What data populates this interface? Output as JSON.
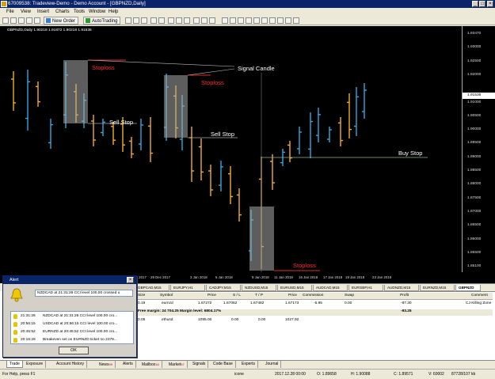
{
  "window": {
    "title": "67009538: Tradeview-Demo - Demo Account - [GBPNZD,Daily]",
    "min": "_",
    "max": "□",
    "close": "×"
  },
  "menu": [
    "File",
    "View",
    "Insert",
    "Charts",
    "Tools",
    "Window",
    "Help"
  ],
  "toolbar": {
    "new_order": "New Order",
    "autotrading": "AutoTrading"
  },
  "chart": {
    "header": "GBPNZD,Daily  1.90218 1.91872 1.90218 1.91536",
    "prices": [
      "1.93470",
      "1.93000",
      "1.92500",
      "1.92000",
      "1.91536",
      "1.91000",
      "1.90500",
      "1.90000",
      "1.89500",
      "1.89000",
      "1.88500",
      "1.88000",
      "1.87500",
      "1.87000",
      "1.86500",
      "1.86000",
      "1.85500",
      "1.85100"
    ],
    "dates": [
      "27 Dec 2017",
      "29 Dec 2017",
      "3 Jan 2018",
      "5 Jan 2018",
      "9 Jan 2018",
      "11 Jan 2018",
      "15 Jan 2018",
      "17 Jan 2018",
      "19 Jan 2018",
      "23 Jan 2018"
    ],
    "labels": {
      "stoploss1": "Stoploss",
      "stoploss2": "Stoploss",
      "stoploss3": "Stoploss",
      "signal": "Signal Candle",
      "sell_stop1": "Sell Stop",
      "sell_stop2": "Sell Stop",
      "buy_stop": "Buy Stop"
    }
  },
  "chart_tabs": [
    "GBPCAD,M15",
    "EURJPY,H1",
    "CADJPY,M15",
    "NZDUSD,M15",
    "EURUSD,M15",
    "AUDCAD,M15",
    "EURGBP,H1",
    "AUDNZD,M15",
    "EURNZD,M15",
    "GBPNZD"
  ],
  "terminal": {
    "columns": [
      "Size",
      "Symbol",
      "Price",
      "S / L",
      "T / P",
      "Price",
      "Commission",
      "Swap",
      "Profit",
      "Comment"
    ],
    "rows": [
      {
        "size": "0.19",
        "symbol": "eurnzd",
        "price": "1.67272",
        "sl": "1.67062",
        "tp": "1.67482",
        "cur": "1.67173",
        "commission": "-5.95",
        "swap": "0.00",
        "profit": "-87.30",
        "comment": "CJ Killing Zone"
      },
      {
        "size": "",
        "symbol": "",
        "price": "",
        "sl": "",
        "tp": "",
        "cur": "",
        "commission": "",
        "swap": "",
        "profit": "-93.25",
        "comment": ""
      },
      {
        "size": "0.05",
        "symbol": "ethusd",
        "price": "1095.00",
        "sl": "0.00",
        "tp": "0.00",
        "cur": "1027.92",
        "commission": "",
        "swap": "",
        "profit": "",
        "comment": ""
      }
    ],
    "margin_text": "Free margin: 24 704.25  Margin level: 6804.17%"
  },
  "bottom_tabs": [
    {
      "label": "Trade"
    },
    {
      "label": "Exposure"
    },
    {
      "label": "Account History"
    },
    {
      "label": "News",
      "badge": "99"
    },
    {
      "label": "Alerts"
    },
    {
      "label": "Mailbox",
      "badge": "16"
    },
    {
      "label": "Market",
      "badge": "57"
    },
    {
      "label": "Signals"
    },
    {
      "label": "Code Base"
    },
    {
      "label": "Experts"
    },
    {
      "label": "Journal"
    }
  ],
  "status": {
    "help": "For Help, press F1",
    "profile": "icone",
    "datetime": "2017.12.28 00:00",
    "open": "O: 1.89658",
    "high": "H: 1.90088",
    "close": "C: 1.89571",
    "volume": "V: 60002",
    "traffic": "87728/107 kb"
  },
  "alert": {
    "title": "Alert",
    "message": "NZDCAD at 21:31:26 CCI level 100.00 crossed u",
    "items": [
      {
        "time": "21:31:26",
        "msg": "NZDCAD at 21:31:26 CCI level 100.00 cro..."
      },
      {
        "time": "20:56:15",
        "msg": "USDCAD at 20:56:15 CCI level 100.00 cro..."
      },
      {
        "time": "20:45:52",
        "msg": "EURNZD at 20:45:52 CCI level 100.00 cro..."
      },
      {
        "time": "20:16:29",
        "msg": "Breakeven set on EURNZD ticket no 2379..."
      }
    ],
    "ok": "OK"
  }
}
